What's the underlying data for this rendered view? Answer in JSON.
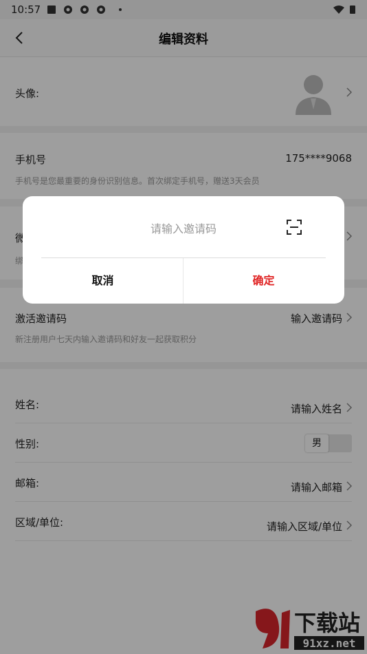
{
  "status_bar": {
    "time": "10:57"
  },
  "nav": {
    "title": "编辑资料"
  },
  "avatar_row": {
    "label": "头像:"
  },
  "phone": {
    "label": "手机号",
    "value": "175****9068",
    "hint": "手机号是您最重要的身份识别信息。首次绑定手机号，赠送3天会员"
  },
  "wechat": {
    "label_fragment": "微",
    "sub_fragment": "绑"
  },
  "invite": {
    "label": "激活邀请码",
    "value": "输入邀请码",
    "hint": "新注册用户七天内输入邀请码和好友一起获取积分"
  },
  "profile": {
    "name_label": "姓名:",
    "name_value": "请输入姓名",
    "gender_label": "性别:",
    "gender_value": "男",
    "email_label": "邮箱:",
    "email_value": "请输入邮箱",
    "region_label": "区域/单位:",
    "region_value": "请输入区域/单位"
  },
  "dialog": {
    "placeholder": "请输入邀请码",
    "cancel": "取消",
    "confirm": "确定"
  },
  "watermark": {
    "text": "下载站",
    "domain": "91xz.net"
  },
  "colors": {
    "confirm": "#e02424",
    "accent_red": "#d9262c"
  }
}
